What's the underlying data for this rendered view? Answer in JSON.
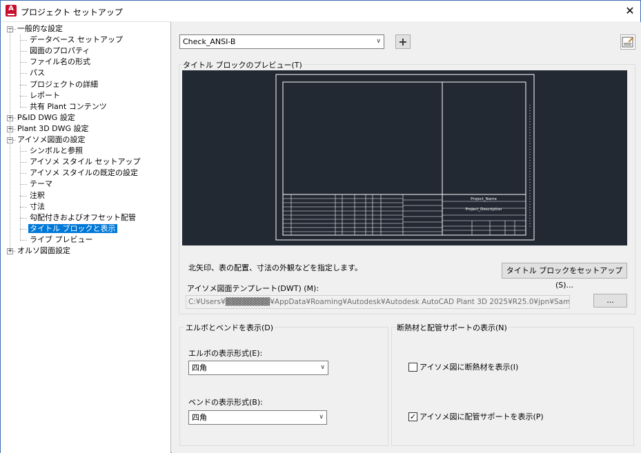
{
  "window": {
    "title": "プロジェクト セットアップ",
    "close": "✕",
    "app_icon": "A"
  },
  "tree": {
    "general": "一般的な設定",
    "general_items": [
      "データベース セットアップ",
      "図面のプロパティ",
      "ファイル名の形式",
      "パス",
      "プロジェクトの詳細",
      "レポート",
      "共有 Plant コンテンツ"
    ],
    "pid": "P&ID DWG 設定",
    "plant3d": "Plant 3D DWG 設定",
    "iso": "アイソメ図面の設定",
    "iso_items": [
      "シンボルと参照",
      "アイソメ スタイル セットアップ",
      "アイソメ スタイルの既定の設定",
      "テーマ",
      "注釈",
      "寸法",
      "勾配付きおよびオフセット配管",
      "タイトル ブロックと表示",
      "ライブ プレビュー"
    ],
    "ortho": "オルソ図面設定",
    "selected": "タイトル ブロックと表示",
    "expand_plus": "+",
    "expand_minus": "−"
  },
  "style_select": {
    "value": "Check_ANSI-B"
  },
  "add_button": "+",
  "preview_group": {
    "title": "タイトル ブロックのプレビュー(T)"
  },
  "titleblock": {
    "project_name": "Project_Name",
    "project_desc": "Project_Description"
  },
  "description": "北矢印、表の配置、寸法の外観などを指定します。",
  "setup_titleblock_button": "タイトル ブロックをセットアップ(S)...",
  "template": {
    "label": "アイソメ図面テンプレート(DWT) (M):",
    "path": "C:¥Users¥▓▓▓▓▓▓▓▓¥AppData¥Roaming¥Autodesk¥Autodesk AutoCAD Plant 3D 2025¥R25.0¥jpn¥SampleProjects",
    "browse": "..."
  },
  "elbow_group": {
    "title": "エルボとベンドを表示(D)",
    "elbow_label": "エルボの表示形式(E):",
    "elbow_value": "四角",
    "bend_label": "ベンドの表示形式(B):",
    "bend_value": "四角"
  },
  "insulation_group": {
    "title": "断熱材と配管サポートの表示(N)",
    "show_insulation": "アイソメ図に断熱材を表示(I)",
    "show_insulation_checked": false,
    "show_support": "アイソメ図に配管サポートを表示(P)",
    "show_support_checked": true
  },
  "icons": [
    "close-icon",
    "plus-icon",
    "edit-titleblock-icon",
    "chevron-down-icon",
    "checkmark-icon"
  ],
  "colors": {
    "selection": "#0078d7",
    "preview_bg": "#222933",
    "app_icon": "#c8102e"
  }
}
